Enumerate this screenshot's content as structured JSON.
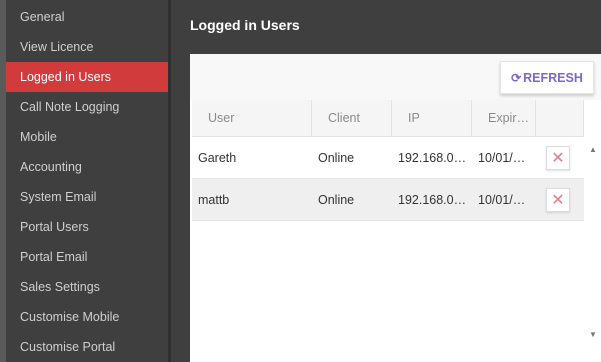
{
  "sidebar": {
    "items": [
      {
        "label": "General"
      },
      {
        "label": "View Licence"
      },
      {
        "label": "Logged in Users",
        "active": true
      },
      {
        "label": "Call Note Logging"
      },
      {
        "label": "Mobile"
      },
      {
        "label": "Accounting"
      },
      {
        "label": "System Email"
      },
      {
        "label": "Portal Users"
      },
      {
        "label": "Portal Email"
      },
      {
        "label": "Sales Settings"
      },
      {
        "label": "Customise Mobile"
      },
      {
        "label": "Customise Portal"
      }
    ]
  },
  "main": {
    "title": "Logged in Users",
    "refresh_label": "REFRESH",
    "refresh_icon": "⟳",
    "columns": [
      "User",
      "Client",
      "IP",
      "Expir…"
    ],
    "rows": [
      {
        "user": "Gareth",
        "client": "Online",
        "ip": "192.168.0…",
        "expiry": "10/01/…"
      },
      {
        "user": "mattb",
        "client": "Online",
        "ip": "192.168.0…",
        "expiry": "10/01/…"
      }
    ],
    "delete_icon": "✕",
    "scroll_up": "▲",
    "scroll_down": "▼"
  },
  "colors": {
    "accent_active": "#d23b3b",
    "refresh_text": "#7e67cc",
    "delete_icon": "#e57a8a"
  }
}
